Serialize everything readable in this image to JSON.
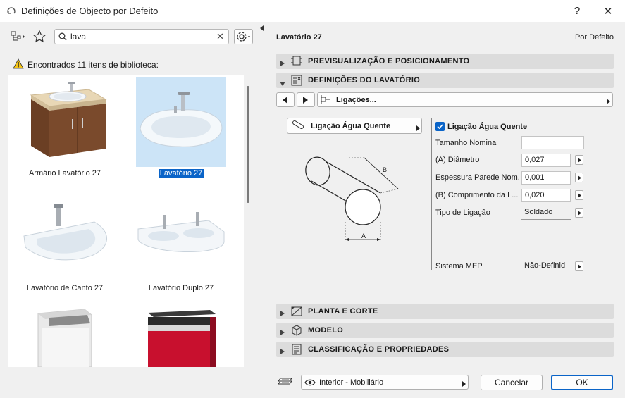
{
  "window": {
    "title": "Definições de Objecto por Defeito",
    "help_label": "?",
    "close_label": "✕"
  },
  "search": {
    "value": "lava",
    "clear_label": "✕"
  },
  "results": {
    "found_text": "Encontrados 11 itens de biblioteca:"
  },
  "library_items": [
    {
      "label": "Armário Lavatório 27"
    },
    {
      "label": "Lavatório 27"
    },
    {
      "label": "Lavatório de Canto 27"
    },
    {
      "label": "Lavatório Duplo 27"
    }
  ],
  "right": {
    "object_name": "Lavatório 27",
    "default_label": "Por Defeito",
    "sections": {
      "preview": "PREVISUALIZAÇÃO E POSICIONAMENTO",
      "settings": "DEFINIÇÕES DO LAVATÓRIO",
      "plan": "PLANTA E CORTE",
      "model": "MODELO",
      "classification": "CLASSIFICAÇÃO E PROPRIEDADES"
    },
    "page_select": "Ligações...",
    "connection_dropdown": "Ligação Água Quente",
    "checkbox_label": "Ligação Água Quente",
    "diagram_labels": {
      "a": "A",
      "b": "B"
    },
    "params": [
      {
        "label": "Tamanho Nominal",
        "value": ""
      },
      {
        "label": "(A) Diâmetro",
        "value": "0,027"
      },
      {
        "label": "Espessura Parede Nom.",
        "value": "0,001"
      },
      {
        "label": "(B) Comprimento da L...",
        "value": "0,020"
      },
      {
        "label": "Tipo de Ligação",
        "value": "Soldado"
      }
    ],
    "mep": {
      "label": "Sistema MEP",
      "value": "Não-Definid"
    }
  },
  "footer": {
    "layer": "Interior - Mobiliário",
    "cancel_label": "Cancelar",
    "ok_label": "OK"
  },
  "colors": {
    "accent": "#0a64c8",
    "selection_bg": "#cce4f7",
    "section_bg": "#dcdcdc"
  }
}
